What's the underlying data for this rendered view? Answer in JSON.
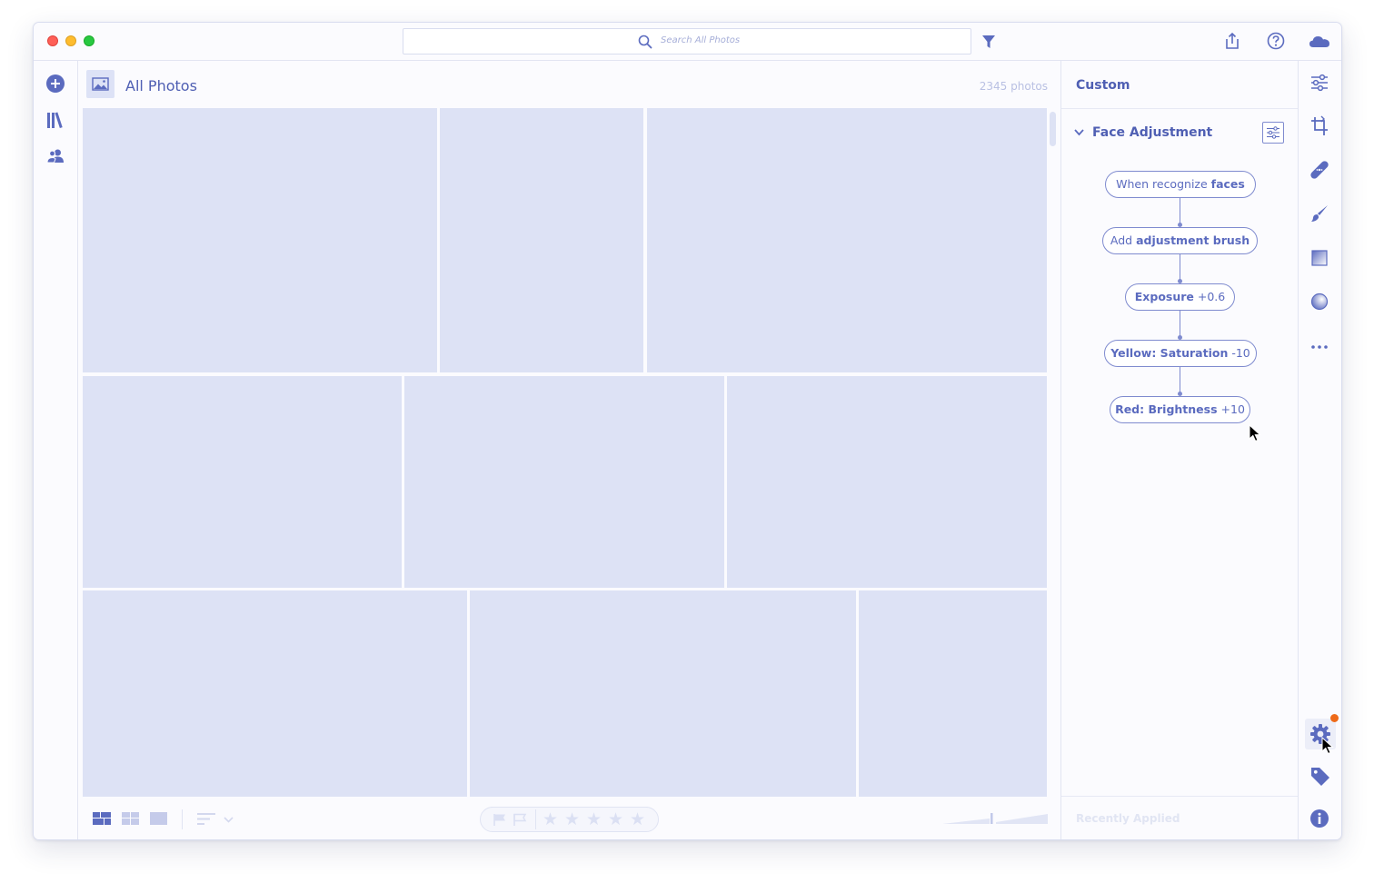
{
  "search": {
    "placeholder": "Search All Photos"
  },
  "main": {
    "title": "All Photos",
    "photo_count": "2345 photos"
  },
  "panel": {
    "title": "Custom",
    "section_title": "Face Adjustment",
    "steps": [
      {
        "regular": "When recognize ",
        "bold": "faces",
        "order": "regular-bold"
      },
      {
        "regular": "Add ",
        "bold": "adjustment brush",
        "order": "regular-bold"
      },
      {
        "bold": "Exposure",
        "regular": " +0.6",
        "order": "bold-regular"
      },
      {
        "bold": "Yellow: Saturation",
        "regular": " -10",
        "order": "bold-regular"
      },
      {
        "bold": "Red: Brightness",
        "regular": " +10",
        "order": "bold-regular"
      }
    ],
    "footer": "Recently Applied"
  },
  "icons": {
    "titlebar": [
      "search-icon",
      "filter-icon",
      "share-icon",
      "help-icon",
      "cloud-icon"
    ],
    "left_rail": [
      "add-icon",
      "library-icon",
      "people-icon"
    ],
    "right_rail": [
      "edit-sliders-icon",
      "crop-icon",
      "healing-icon",
      "brush-icon",
      "linear-gradient-icon",
      "radial-gradient-icon",
      "more-icon",
      "settings-icon",
      "tag-icon",
      "info-icon"
    ]
  },
  "colors": {
    "accent": "#4f5fb3",
    "placeholder_tile": "#dde2f5",
    "notification_badge": "#ee6a19"
  }
}
